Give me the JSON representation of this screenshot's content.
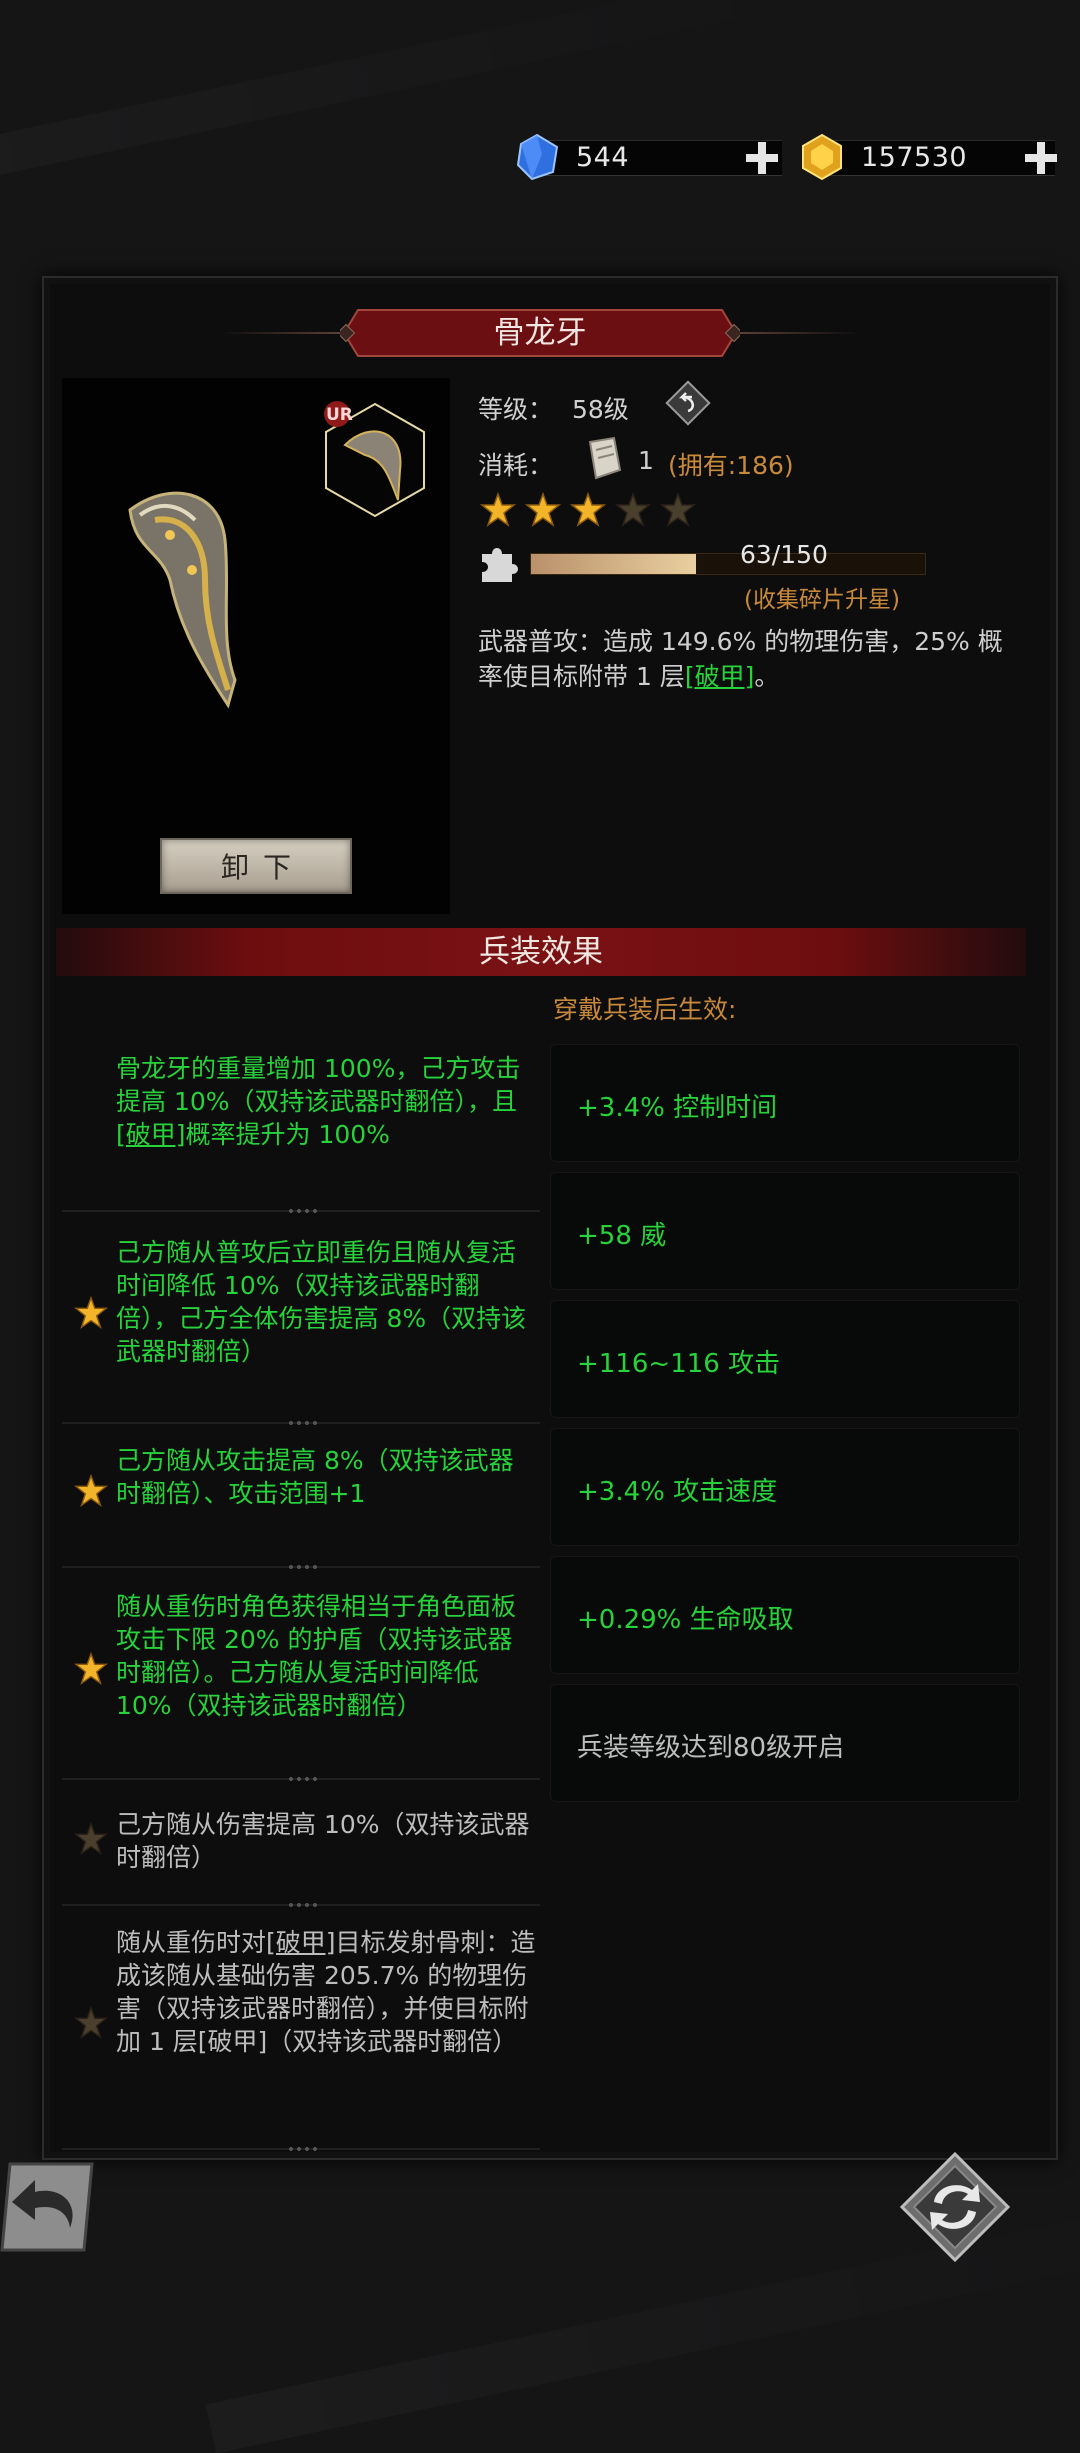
{
  "currency": {
    "gems": "544",
    "gold": "157530"
  },
  "item": {
    "name": "骨龙牙",
    "rarity_badge": "UR",
    "level_label": "等级：",
    "level_value": "58级",
    "cost_label": "消耗：",
    "cost_value": "1",
    "owned": "(拥有:186)",
    "stars_filled": 3,
    "stars_total": 5,
    "fragments_text": "63/150",
    "fragments_progress": 0.42,
    "fragments_hint": "(收集碎片升星)",
    "desc_prefix": "武器普攻：造成 149.6% 的物理伤害，25% 概率使目标附带 1 层",
    "desc_link": "[破甲]",
    "desc_suffix": "。",
    "unequip_label": "卸下"
  },
  "section": {
    "title": "兵装效果",
    "subtitle": "穿戴兵装后生效:"
  },
  "effects": [
    {
      "pre": "骨龙牙的重量增加 100%，己方攻击提高 10%（双持该武器时翻倍），且",
      "link": "[破甲]",
      "post": "概率提升为 100%",
      "star": false,
      "active": true
    },
    {
      "pre": "己方随从普攻后立即重伤且随从复活时间降低 10%（双持该武器时翻倍），己方全体伤害提高 8%（双持该武器时翻倍）",
      "link": "",
      "post": "",
      "star": true,
      "active": true
    },
    {
      "pre": "己方随从攻击提高 8%（双持该武器时翻倍）、攻击范围+1",
      "link": "",
      "post": "",
      "star": true,
      "active": true
    },
    {
      "pre": "随从重伤时角色获得相当于角色面板攻击下限 20% 的护盾（双持该武器时翻倍）。己方随从复活时间降低 10%（双持该武器时翻倍）",
      "link": "",
      "post": "",
      "star": true,
      "active": true
    },
    {
      "pre": "己方随从伤害提高 10%（双持该武器时翻倍）",
      "link": "",
      "post": "",
      "star": true,
      "active": false
    },
    {
      "pre": "随从重伤时对",
      "link": "[破甲]",
      "post": "目标发射骨刺：造成该随从基础伤害 205.7% 的物理伤害（双持该武器时翻倍），并使目标附加 1 层[破甲]（双持该武器时翻倍）",
      "star": true,
      "active": false
    }
  ],
  "stats": [
    {
      "text": "+3.4% 控制时间",
      "active": true
    },
    {
      "text": "+58 威",
      "active": true
    },
    {
      "text": "+116~116 攻击",
      "active": true
    },
    {
      "text": "+3.4% 攻击速度",
      "active": true
    },
    {
      "text": "+0.29% 生命吸取",
      "active": true
    },
    {
      "text": "兵装等级达到80级开启",
      "active": false
    }
  ],
  "colors": {
    "green": "#27d23a",
    "orange": "#c9893a",
    "gold_star": "#f2b52a",
    "dark_star": "#4a3e2c"
  }
}
